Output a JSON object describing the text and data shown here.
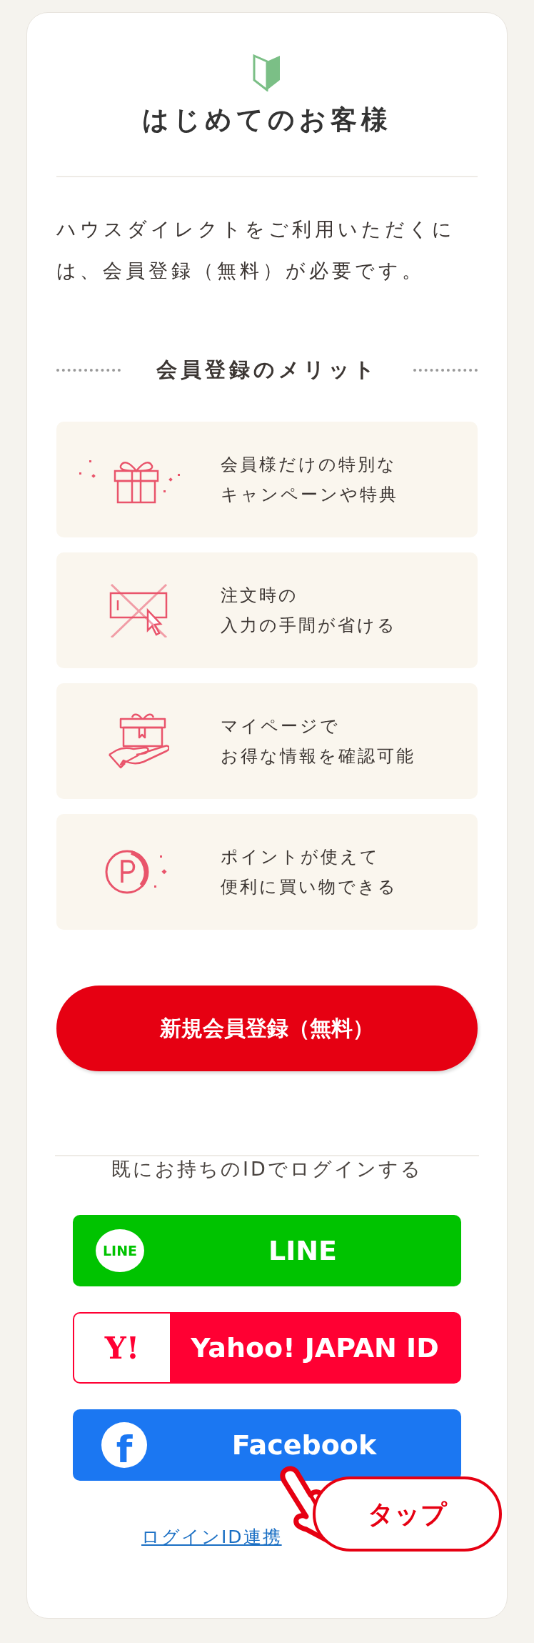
{
  "header": {
    "title": "はじめてのお客様"
  },
  "intro": "ハウスダイレクトをご利用いただくには、会員登録（無料）が必要です。",
  "merits_heading": "会員登録のメリット",
  "merits": [
    {
      "kind": "gift",
      "lines": [
        "会員様だけの特別な",
        "キャンペーンや特典"
      ]
    },
    {
      "kind": "no-input",
      "lines": [
        "注文時の",
        "入力の手間が省ける"
      ]
    },
    {
      "kind": "hand-gift",
      "lines": [
        "マイページで",
        "お得な情報を確認可能"
      ]
    },
    {
      "kind": "points",
      "lines": [
        "ポイントが使えて",
        "便利に買い物できる"
      ]
    }
  ],
  "register_button": "新規会員登録（無料）",
  "login_heading": "既にお持ちのIDでログインする",
  "login_buttons": [
    {
      "kind": "line",
      "logo_text": "LINE",
      "label": "LINE"
    },
    {
      "kind": "yahoo",
      "logo_text": "Y!",
      "label": "Yahoo! JAPAN ID"
    },
    {
      "kind": "facebook",
      "logo_text": "f",
      "label": "Facebook"
    }
  ],
  "link": "ログインID連携",
  "tap_hint": {
    "label": "タップ"
  }
}
